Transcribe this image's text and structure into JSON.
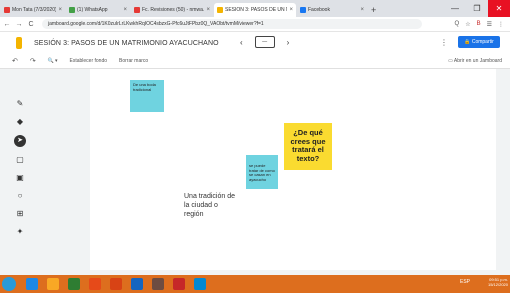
{
  "browser": {
    "tabs": [
      {
        "label": "Mon Tata (7/3/2020)",
        "favicon_color": "#e53935"
      },
      {
        "label": "(1) WhatsApp",
        "favicon_color": "#43a047"
      },
      {
        "label": "Fc. Revisiones (50) - nmwa.satol",
        "favicon_color": "#e53935"
      },
      {
        "label": "SESIÓN 3: PASOS DE UN MAT",
        "favicon_color": "#f4b400",
        "active": true
      },
      {
        "label": "Facebook",
        "favicon_color": "#1877f2"
      }
    ],
    "new_tab": "+",
    "window_controls": {
      "minimize": "—",
      "maximize": "❐",
      "close": "✕"
    },
    "back": "←",
    "forward": "→",
    "reload": "C",
    "url": "jamboard.google.com/d/1K0zuIrLrLKwkhRqIOC4sbzxG-Pfc6uJtFPbz0Q_VAObt/tvmM/viewer?f=1",
    "right_icons": [
      "Q",
      "☆",
      "B",
      "☰",
      "⋮"
    ]
  },
  "app": {
    "title": "SESIÓN 3: PASOS DE UN MATRIMONIO AYACUCHANO",
    "prev_frame": "‹",
    "next_frame": "›",
    "frame_thumb": "—",
    "menu": "⋮",
    "share_label": "Compartir"
  },
  "toolbar": {
    "undo": "↶",
    "redo": "↷",
    "zoom": "🔍",
    "zoom_caret": "▾",
    "set_background": "Establecer fondo",
    "clear_frame": "Borrar marco",
    "open_in_jamboard": "Abrir en un Jamboard"
  },
  "left_tools": {
    "pen": "✎",
    "eraser": "◆",
    "select": "➤",
    "sticky_note": "▢",
    "image": "▣",
    "circle": "○",
    "text_box": "⊞",
    "laser": "✦"
  },
  "canvas": {
    "note1": "De una boda tradicional",
    "note2": "se puede tratar de como se casan en ayacucho",
    "note3": "¿De qué crees que tratará el texto?",
    "freetext": "Una tradición de la ciudad o región"
  },
  "colors": {
    "sticky_blue": "#6fd3e0",
    "sticky_yellow": "#fadb30",
    "share_blue": "#1a73e8",
    "taskbar_orange": "#dd6e1e",
    "jamboard_logo": "#f4b400"
  },
  "taskbar": {
    "apps": [
      {
        "name": "internet-explorer",
        "color": "#1e88e5"
      },
      {
        "name": "file-explorer",
        "color": "#f9a825"
      },
      {
        "name": "excel",
        "color": "#2e7d32"
      },
      {
        "name": "media-player",
        "color": "#e64a19"
      },
      {
        "name": "powerpoint",
        "color": "#d84315"
      },
      {
        "name": "word",
        "color": "#1565c0"
      },
      {
        "name": "notes",
        "color": "#6d4c41"
      },
      {
        "name": "chrome",
        "color": "#c62828"
      },
      {
        "name": "skype",
        "color": "#0288d1"
      }
    ],
    "tray": "ESP",
    "time": "09:51 p.m.",
    "date": "15/12/2020"
  }
}
